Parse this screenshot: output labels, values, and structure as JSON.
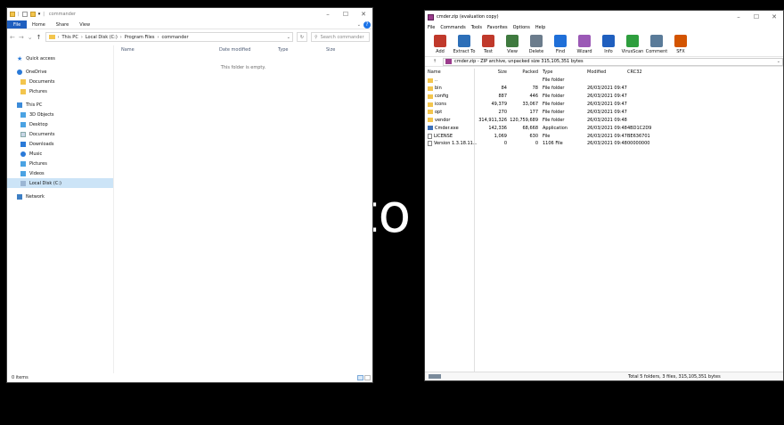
{
  "background_text": "to",
  "explorer": {
    "title": "commander",
    "ribbon_tabs": [
      "File",
      "Home",
      "Share",
      "View"
    ],
    "address": {
      "crumbs": [
        "This PC",
        "Local Disk (C:)",
        "Program Files",
        "commander"
      ],
      "search_placeholder": "Search commander"
    },
    "nav": [
      {
        "label": "Quick access",
        "icon": "star-icon",
        "level": 0
      },
      {
        "label": "OneDrive",
        "icon": "cloud-icon",
        "level": 0
      },
      {
        "label": "Documents",
        "icon": "folder-icon",
        "level": 1
      },
      {
        "label": "Pictures",
        "icon": "folder-icon",
        "level": 1
      },
      {
        "label": "This PC",
        "icon": "computer-icon",
        "level": 0
      },
      {
        "label": "3D Objects",
        "icon": "cube-icon",
        "level": 1
      },
      {
        "label": "Desktop",
        "icon": "desktop-icon",
        "level": 1
      },
      {
        "label": "Documents",
        "icon": "document-icon",
        "level": 1
      },
      {
        "label": "Downloads",
        "icon": "download-icon",
        "level": 1
      },
      {
        "label": "Music",
        "icon": "music-icon",
        "level": 1
      },
      {
        "label": "Pictures",
        "icon": "picture-icon",
        "level": 1
      },
      {
        "label": "Videos",
        "icon": "video-icon",
        "level": 1
      },
      {
        "label": "Local Disk (C:)",
        "icon": "drive-icon",
        "level": 1,
        "selected": true
      },
      {
        "label": "Network",
        "icon": "network-icon",
        "level": 0
      }
    ],
    "columns": [
      "Name",
      "Date modified",
      "Type",
      "Size"
    ],
    "empty_message": "This folder is empty.",
    "status": "0 items"
  },
  "winrar": {
    "title": "cmder.zip (evaluation copy)",
    "menu": [
      "File",
      "Commands",
      "Tools",
      "Favorites",
      "Options",
      "Help"
    ],
    "toolbar": [
      {
        "label": "Add",
        "color": "#c0392b"
      },
      {
        "label": "Extract To",
        "color": "#2d6fb8"
      },
      {
        "label": "Test",
        "color": "#c0392b"
      },
      {
        "label": "View",
        "color": "#3f7a3f"
      },
      {
        "label": "Delete",
        "color": "#6b7c8c"
      },
      {
        "label": "Find",
        "color": "#1f6fd8"
      },
      {
        "label": "Wizard",
        "color": "#9b59b6"
      },
      {
        "label": "Info",
        "color": "#1f5fbf"
      },
      {
        "label": "VirusScan",
        "color": "#2e9e3e"
      },
      {
        "label": "Comment",
        "color": "#5a7b99"
      },
      {
        "label": "SFX",
        "color": "#d35400"
      }
    ],
    "path": "cmder.zip - ZIP archive, unpacked size 315,105,351 bytes",
    "columns": [
      "Name",
      "Size",
      "Packed",
      "Type",
      "Modified",
      "CRC32"
    ],
    "rows": [
      {
        "name": "..",
        "size": "",
        "packed": "",
        "type": "File folder",
        "modified": "",
        "crc": "",
        "kind": "folder"
      },
      {
        "name": "bin",
        "size": "84",
        "packed": "78",
        "type": "File folder",
        "modified": "26/03/2021 09:47",
        "crc": "",
        "kind": "folder"
      },
      {
        "name": "config",
        "size": "887",
        "packed": "446",
        "type": "File folder",
        "modified": "26/03/2021 09:47",
        "crc": "",
        "kind": "folder"
      },
      {
        "name": "icons",
        "size": "49,379",
        "packed": "33,067",
        "type": "File folder",
        "modified": "26/03/2021 09:47",
        "crc": "",
        "kind": "folder"
      },
      {
        "name": "opt",
        "size": "270",
        "packed": "177",
        "type": "File folder",
        "modified": "26/03/2021 09:47",
        "crc": "",
        "kind": "folder"
      },
      {
        "name": "vendor",
        "size": "314,911,326",
        "packed": "120,759,689",
        "type": "File folder",
        "modified": "26/03/2021 09:48",
        "crc": "",
        "kind": "folder"
      },
      {
        "name": "Cmder.exe",
        "size": "142,336",
        "packed": "68,668",
        "type": "Application",
        "modified": "26/03/2021 09:48",
        "crc": "4BD1C2D9",
        "kind": "exe"
      },
      {
        "name": "LICENSE",
        "size": "1,069",
        "packed": "630",
        "type": "File",
        "modified": "26/03/2021 09:47",
        "crc": "BE636701",
        "kind": "file"
      },
      {
        "name": "Version 1.3.18.11...",
        "size": "0",
        "packed": "0",
        "type": "1106 File",
        "modified": "26/03/2021 09:48",
        "crc": "00000000",
        "kind": "file"
      }
    ],
    "status_total": "Total 5 folders, 3 files, 315,105,351 bytes"
  }
}
